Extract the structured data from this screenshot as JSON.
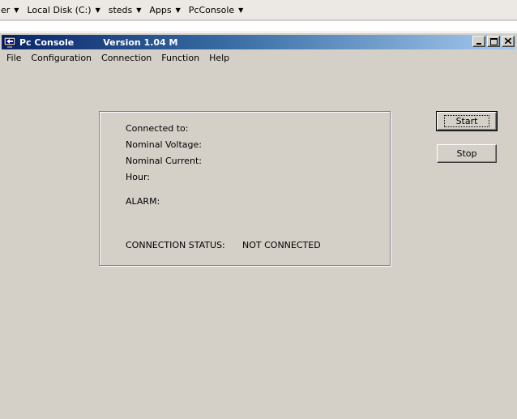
{
  "breadcrumb": {
    "items": [
      {
        "label": "er"
      },
      {
        "label": "Local Disk (C:)"
      },
      {
        "label": "steds"
      },
      {
        "label": "Apps"
      },
      {
        "label": "PcConsole"
      }
    ]
  },
  "window": {
    "title": "Pc Console",
    "version": "Version 1.04 M",
    "icon": "app-icon"
  },
  "menu": {
    "items": [
      {
        "label": "File"
      },
      {
        "label": "Configuration"
      },
      {
        "label": "Connection"
      },
      {
        "label": "Function"
      },
      {
        "label": "Help"
      }
    ]
  },
  "status_panel": {
    "connected_to_label": "Connected to:",
    "nominal_voltage_label": "Nominal Voltage:",
    "nominal_current_label": "Nominal Current:",
    "hour_label": "Hour:",
    "alarm_label": "ALARM:",
    "connection_status_label": "CONNECTION STATUS:",
    "connection_status_value": "NOT CONNECTED"
  },
  "buttons": {
    "start": "Start",
    "stop": "Stop"
  }
}
